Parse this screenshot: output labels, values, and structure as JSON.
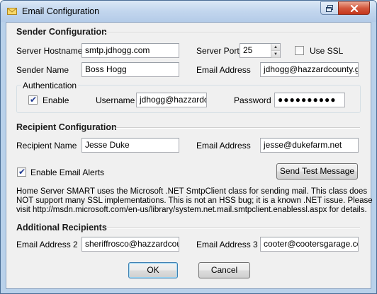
{
  "window": {
    "title": "Email Configuration",
    "icons": {
      "app": "envelope-icon",
      "restore": "restore-window-icon",
      "close": "close-x-icon"
    }
  },
  "sender": {
    "title": "Sender Configuration",
    "hostname_label": "Server Hostname",
    "hostname_value": "smtp.jdhogg.com",
    "port_label": "Server Port",
    "port_value": "25",
    "use_ssl_label": "Use SSL",
    "use_ssl_checked": false,
    "name_label": "Sender Name",
    "name_value": "Boss Hogg",
    "email_label": "Email Address",
    "email_value": "jdhogg@hazzardcounty.gov"
  },
  "auth": {
    "title": "Authentication",
    "enable_label": "Enable",
    "enable_checked": true,
    "username_label": "Username",
    "username_value": "jdhogg@hazzardcounty.gov",
    "password_label": "Password",
    "password_value": "●●●●●●●●●●"
  },
  "recipient": {
    "title": "Recipient Configuration",
    "name_label": "Recipient Name",
    "name_value": "Jesse Duke",
    "email_label": "Email Address",
    "email_value": "jesse@dukefarm.net",
    "alerts_label": "Enable Email Alerts",
    "alerts_checked": true,
    "test_button": "Send Test Message"
  },
  "note": {
    "line1": "Home Server SMART uses the Microsoft .NET SmtpClient class for sending mail. This class does",
    "line2": "NOT support many SSL implementations. This is not an HSS bug; it is a known .NET issue. Please",
    "line3": "visit http://msdn.microsoft.com/en-us/library/system.net.mail.smtpclient.enablessl.aspx for details."
  },
  "additional": {
    "title": "Additional Recipients",
    "email2_label": "Email Address 2",
    "email2_value": "sheriffrosco@hazzardcounty.gov",
    "email3_label": "Email Address 3",
    "email3_value": "cooter@cootersgarage.com"
  },
  "buttons": {
    "ok": "OK",
    "cancel": "Cancel"
  }
}
